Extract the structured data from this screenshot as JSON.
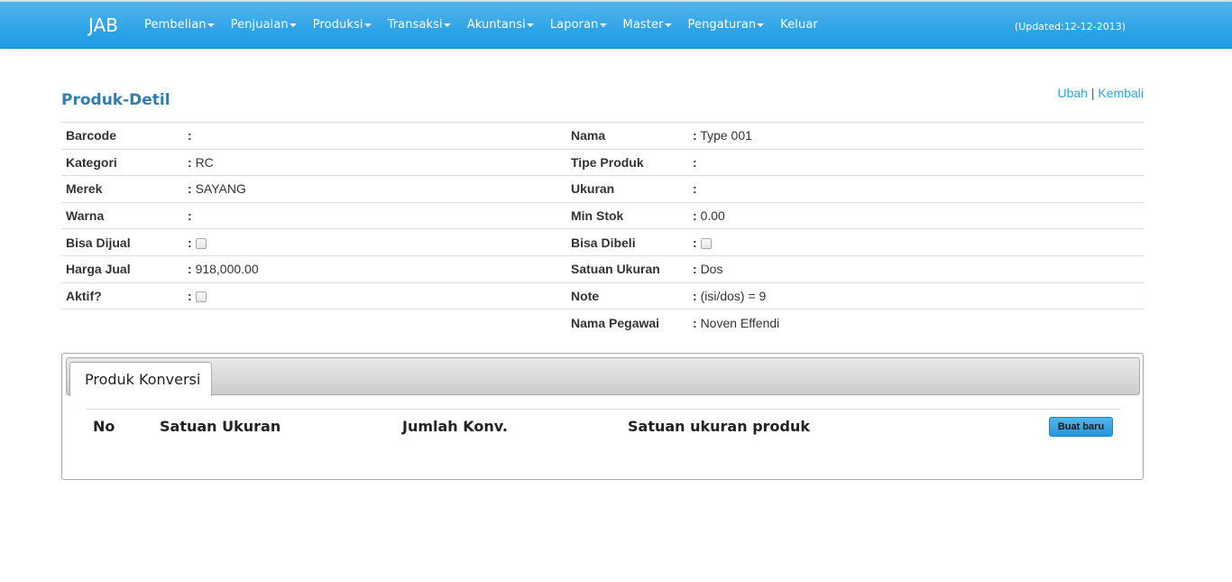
{
  "navbar": {
    "brand": "JAB",
    "menu": [
      {
        "label": "Pembelian",
        "dropdown": true
      },
      {
        "label": "Penjualan",
        "dropdown": true
      },
      {
        "label": "Produksi",
        "dropdown": true
      },
      {
        "label": "Transaksi",
        "dropdown": true
      },
      {
        "label": "Akuntansi",
        "dropdown": true
      },
      {
        "label": "Laporan",
        "dropdown": true
      },
      {
        "label": "Master",
        "dropdown": true
      },
      {
        "label": "Pengaturan",
        "dropdown": true
      },
      {
        "label": "Keluar",
        "dropdown": false
      }
    ],
    "updated": "(Updated:12-12-2013)"
  },
  "page": {
    "title": "Produk-Detil",
    "actions": {
      "edit": "Ubah",
      "separator": "|",
      "back": "Kembali"
    }
  },
  "detail": {
    "left": [
      {
        "label": "Barcode",
        "sep": ":",
        "value": ""
      },
      {
        "label": "Kategori",
        "sep": ":",
        "value": "RC"
      },
      {
        "label": "Merek",
        "sep": ":",
        "value": "SAYANG"
      },
      {
        "label": "Warna",
        "sep": ":",
        "value": ""
      },
      {
        "label": "Bisa Dijual",
        "sep": ":",
        "checked": false
      },
      {
        "label": "Harga Jual",
        "sep": ":",
        "value": "918,000.00"
      },
      {
        "label": "Aktif?",
        "sep": ":",
        "checked": false
      }
    ],
    "right": [
      {
        "label": "Nama",
        "sep": ":",
        "value": "Type 001"
      },
      {
        "label": "Tipe Produk",
        "sep": ":",
        "value": ""
      },
      {
        "label": "Ukuran",
        "sep": ":",
        "value": ""
      },
      {
        "label": "Min Stok",
        "sep": ":",
        "value": "0.00"
      },
      {
        "label": "Bisa Dibeli",
        "sep": ":",
        "checked": false
      },
      {
        "label": "Satuan Ukuran",
        "sep": ":",
        "value": "Dos"
      },
      {
        "label": "Note",
        "sep": ":",
        "value": "(isi/dos) = 9"
      },
      {
        "label": "Nama Pegawai",
        "sep": ":",
        "value": "Noven Effendi"
      }
    ]
  },
  "tabs": {
    "active": "Produk Konversi",
    "table": {
      "columns": [
        "No",
        "Satuan Ukuran",
        "Jumlah Konv.",
        "Satuan ukuran produk"
      ],
      "new_button": "Buat baru"
    }
  },
  "colors": {
    "navbar": "#2fa4e7",
    "title": "#317eac",
    "link": "#2fa4e7"
  }
}
